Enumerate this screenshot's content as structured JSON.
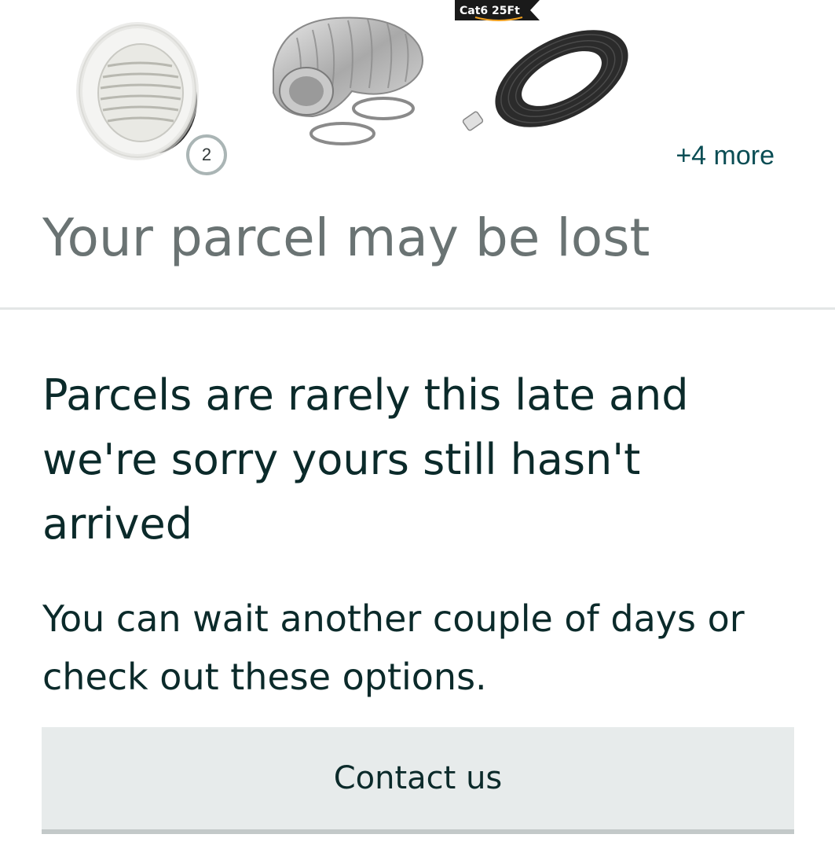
{
  "products": {
    "items": [
      {
        "name": "round-vent-cover",
        "icon": "vent-image"
      },
      {
        "name": "flexible-duct-hose",
        "icon": "duct-image"
      },
      {
        "name": "flat-ethernet-cable",
        "icon": "cable-image",
        "tag": "Cat6 25Ft"
      }
    ],
    "quantity_badge": "2",
    "more_label": "+4 more"
  },
  "status": {
    "title": "Your parcel may be lost"
  },
  "message": {
    "headline": "Parcels are rarely this late and we're sorry yours still hasn't arrived",
    "subtext": "You can wait another couple of days or check out these options."
  },
  "actions": {
    "contact_label": "Contact us"
  },
  "colors": {
    "title_grey": "#6a7373",
    "body_text": "#0b2a2a",
    "link_teal": "#0a4d54",
    "button_bg": "#e7ebeb"
  }
}
